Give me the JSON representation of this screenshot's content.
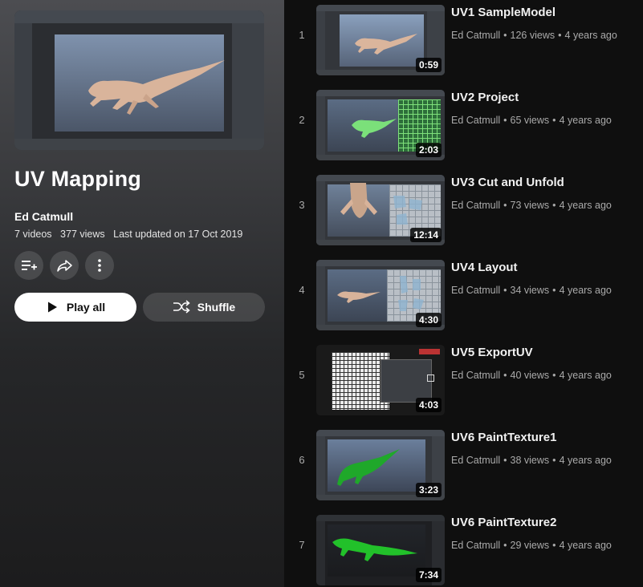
{
  "playlist": {
    "title": "UV Mapping",
    "owner": "Ed Catmull",
    "video_count": "7 videos",
    "views": "377 views",
    "last_updated": "Last updated on 17 Oct 2019",
    "play_all_label": "Play all",
    "shuffle_label": "Shuffle",
    "actions": {
      "save_icon": "playlist-add-icon",
      "share_icon": "share-icon",
      "more_icon": "more-vert-icon"
    }
  },
  "videos": [
    {
      "index": "1",
      "title": "UV1 SampleModel",
      "channel": "Ed Catmull",
      "views": "126 views",
      "age": "4 years ago",
      "duration": "0:59"
    },
    {
      "index": "2",
      "title": "UV2 Project",
      "channel": "Ed Catmull",
      "views": "65 views",
      "age": "4 years ago",
      "duration": "2:03"
    },
    {
      "index": "3",
      "title": "UV3 Cut and Unfold",
      "channel": "Ed Catmull",
      "views": "73 views",
      "age": "4 years ago",
      "duration": "12:14"
    },
    {
      "index": "4",
      "title": "UV4 Layout",
      "channel": "Ed Catmull",
      "views": "34 views",
      "age": "4 years ago",
      "duration": "4:30"
    },
    {
      "index": "5",
      "title": "UV5 ExportUV",
      "channel": "Ed Catmull",
      "views": "40 views",
      "age": "4 years ago",
      "duration": "4:03"
    },
    {
      "index": "6",
      "title": "UV6 PaintTexture1",
      "channel": "Ed Catmull",
      "views": "38 views",
      "age": "4 years ago",
      "duration": "3:23"
    },
    {
      "index": "7",
      "title": "UV6 PaintTexture2",
      "channel": "Ed Catmull",
      "views": "29 views",
      "age": "4 years ago",
      "duration": "7:34"
    }
  ],
  "colors": {
    "background": "#0f0f0f",
    "panel_top": "#4c4d51",
    "text_primary": "#f1f1f1",
    "text_secondary": "#aaaaaa",
    "model_skin": "#d9b49b",
    "paint_green": "#1fa82a"
  }
}
